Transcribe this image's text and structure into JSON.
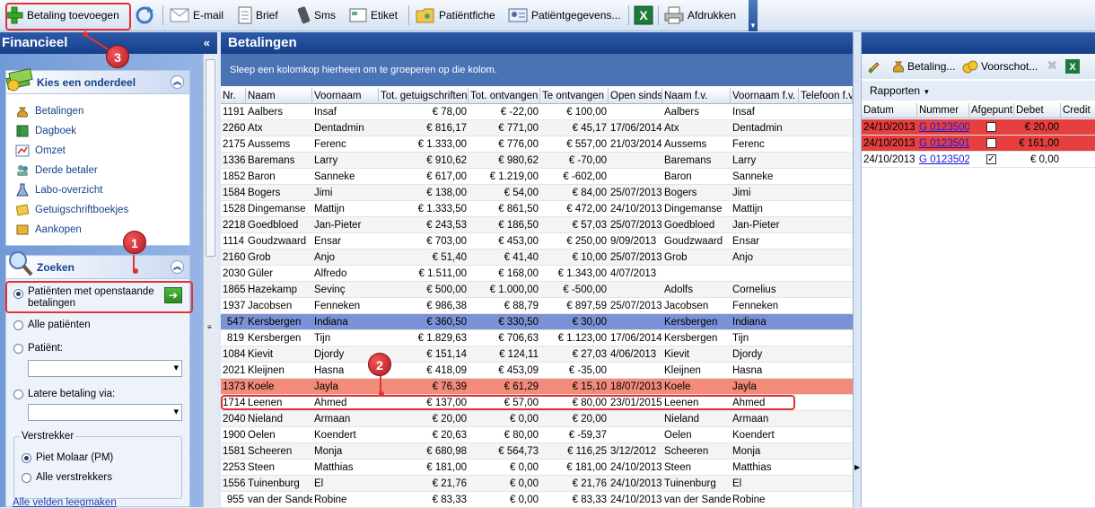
{
  "toolbar": {
    "add_payment": "Betaling toevoegen",
    "email": "E-mail",
    "letter": "Brief",
    "sms": "Sms",
    "label": "Etiket",
    "patient_sheet": "Patiëntfiche",
    "patient_data": "Patiëntgegevens...",
    "print": "Afdrukken"
  },
  "left": {
    "title": "Financieel",
    "collapse": "«",
    "section1_title": "Kies een onderdeel",
    "items": [
      "Betalingen",
      "Dagboek",
      "Omzet",
      "Derde betaler",
      "Labo-overzicht",
      "Getuigschriftboekjes",
      "Aankopen"
    ],
    "section2_title": "Zoeken",
    "radio_open": "Patiënten met openstaande betalingen",
    "radio_all": "Alle patiënten",
    "radio_patient": "Patiënt:",
    "radio_later": "Latere betaling via:",
    "group_title": "Verstrekker",
    "prov_piet": "Piet Molaar (PM)",
    "prov_all": "Alle verstrekkers",
    "clear_fields": "Alle velden leegmaken"
  },
  "center": {
    "title": "Betalingen",
    "group_hint": "Sleep een kolomkop hierheen om te groeperen op die kolom.",
    "columns": [
      "Nr.",
      "Naam",
      "Voornaam",
      "Tot. getuigschriften",
      "Tot. ontvangen",
      "Te ontvangen",
      "Open sinds",
      "Naam f.v.",
      "Voornaam f.v.",
      "Telefoon f.v"
    ],
    "rows": [
      [
        "1191",
        "Aalbers",
        "Insaf",
        "€ 78,00",
        "€ -22,00",
        "€ 100,00",
        "",
        "Aalbers",
        "Insaf"
      ],
      [
        "2260",
        "Atx",
        "Dentadmin",
        "€ 816,17",
        "€ 771,00",
        "€ 45,17",
        "17/06/2014",
        "Atx",
        "Dentadmin"
      ],
      [
        "2175",
        "Aussems",
        "Ferenc",
        "€ 1.333,00",
        "€ 776,00",
        "€ 557,00",
        "21/03/2014",
        "Aussems",
        "Ferenc"
      ],
      [
        "1336",
        "Baremans",
        "Larry",
        "€ 910,62",
        "€ 980,62",
        "€ -70,00",
        "",
        "Baremans",
        "Larry"
      ],
      [
        "1852",
        "Baron",
        "Sanneke",
        "€ 617,00",
        "€ 1.219,00",
        "€ -602,00",
        "",
        "Baron",
        "Sanneke"
      ],
      [
        "1584",
        "Bogers",
        "Jimi",
        "€ 138,00",
        "€ 54,00",
        "€ 84,00",
        "25/07/2013",
        "Bogers",
        "Jimi"
      ],
      [
        "1528",
        "Dingemanse",
        "Mattijn",
        "€ 1.333,50",
        "€ 861,50",
        "€ 472,00",
        "24/10/2013",
        "Dingemanse",
        "Mattijn"
      ],
      [
        "2218",
        "Goedbloed",
        "Jan-Pieter",
        "€ 243,53",
        "€ 186,50",
        "€ 57,03",
        "25/07/2013",
        "Goedbloed",
        "Jan-Pieter"
      ],
      [
        "1114",
        "Goudzwaard",
        "Ensar",
        "€ 703,00",
        "€ 453,00",
        "€ 250,00",
        "9/09/2013",
        "Goudzwaard",
        "Ensar"
      ],
      [
        "2160",
        "Grob",
        "Anjo",
        "€ 51,40",
        "€ 41,40",
        "€ 10,00",
        "25/07/2013",
        "Grob",
        "Anjo"
      ],
      [
        "2030",
        "Güler",
        "Alfredo",
        "€ 1.511,00",
        "€ 168,00",
        "€ 1.343,00",
        "4/07/2013",
        "",
        ""
      ],
      [
        "1865",
        "Hazekamp",
        "Sevinç",
        "€ 500,00",
        "€ 1.000,00",
        "€ -500,00",
        "",
        "Adolfs",
        "Cornelius"
      ],
      [
        "1937",
        "Jacobsen",
        "Fenneken",
        "€ 986,38",
        "€ 88,79",
        "€ 897,59",
        "25/07/2013",
        "Jacobsen",
        "Fenneken"
      ],
      [
        "547",
        "Kersbergen",
        "Indiana",
        "€ 360,50",
        "€ 330,50",
        "€ 30,00",
        "",
        "Kersbergen",
        "Indiana"
      ],
      [
        "819",
        "Kersbergen",
        "Tijn",
        "€ 1.829,63",
        "€ 706,63",
        "€ 1.123,00",
        "17/06/2014",
        "Kersbergen",
        "Tijn"
      ],
      [
        "1084",
        "Kievit",
        "Djordy",
        "€ 151,14",
        "€ 124,11",
        "€ 27,03",
        "4/06/2013",
        "Kievit",
        "Djordy"
      ],
      [
        "2021",
        "Kleijnen",
        "Hasna",
        "€ 418,09",
        "€ 453,09",
        "€ -35,00",
        "",
        "Kleijnen",
        "Hasna"
      ],
      [
        "1373",
        "Koele",
        "Jayla",
        "€ 76,39",
        "€ 61,29",
        "€ 15,10",
        "18/07/2013",
        "Koele",
        "Jayla"
      ],
      [
        "1714",
        "Leenen",
        "Ahmed",
        "€ 137,00",
        "€ 57,00",
        "€ 80,00",
        "23/01/2015",
        "Leenen",
        "Ahmed"
      ],
      [
        "2040",
        "Nieland",
        "Armaan",
        "€ 20,00",
        "€ 0,00",
        "€ 20,00",
        "",
        "Nieland",
        "Armaan"
      ],
      [
        "1900",
        "Oelen",
        "Koendert",
        "€ 20,63",
        "€ 80,00",
        "€ -59,37",
        "",
        "Oelen",
        "Koendert"
      ],
      [
        "1581",
        "Scheeren",
        "Monja",
        "€ 680,98",
        "€ 564,73",
        "€ 116,25",
        "3/12/2012",
        "Scheeren",
        "Monja"
      ],
      [
        "2253",
        "Steen",
        "Matthias",
        "€ 181,00",
        "€ 0,00",
        "€ 181,00",
        "24/10/2013",
        "Steen",
        "Matthias"
      ],
      [
        "1556",
        "Tuinenburg",
        "El",
        "€ 21,76",
        "€ 0,00",
        "€ 21,76",
        "24/10/2013",
        "Tuinenburg",
        "El"
      ],
      [
        "955",
        "van der Sande",
        "Robine",
        "€ 83,33",
        "€ 0,00",
        "€ 83,33",
        "24/10/2013",
        "van der Sande",
        "Robine"
      ]
    ]
  },
  "right": {
    "tb_payment": "Betaling...",
    "tb_advance": "Voorschot...",
    "reports": "Rapporten",
    "columns": [
      "Datum",
      "Nummer",
      "Afgepunt",
      "Debet",
      "Credit"
    ],
    "rows": [
      {
        "date": "24/10/2013",
        "number": "G 0123500",
        "checked": false,
        "debit": "€ 20,00"
      },
      {
        "date": "24/10/2013",
        "number": "G 0123501",
        "checked": false,
        "debit": "€ 161,00"
      },
      {
        "date": "24/10/2013",
        "number": "G 0123502",
        "checked": true,
        "debit": "€ 0,00"
      }
    ]
  },
  "annotations": [
    "1",
    "2",
    "3"
  ],
  "colors": {
    "highlight_blue": "#7b93d6",
    "highlight_red": "#f28b79",
    "alert_red": "#e53f3f",
    "annotation_red": "#e23234"
  }
}
